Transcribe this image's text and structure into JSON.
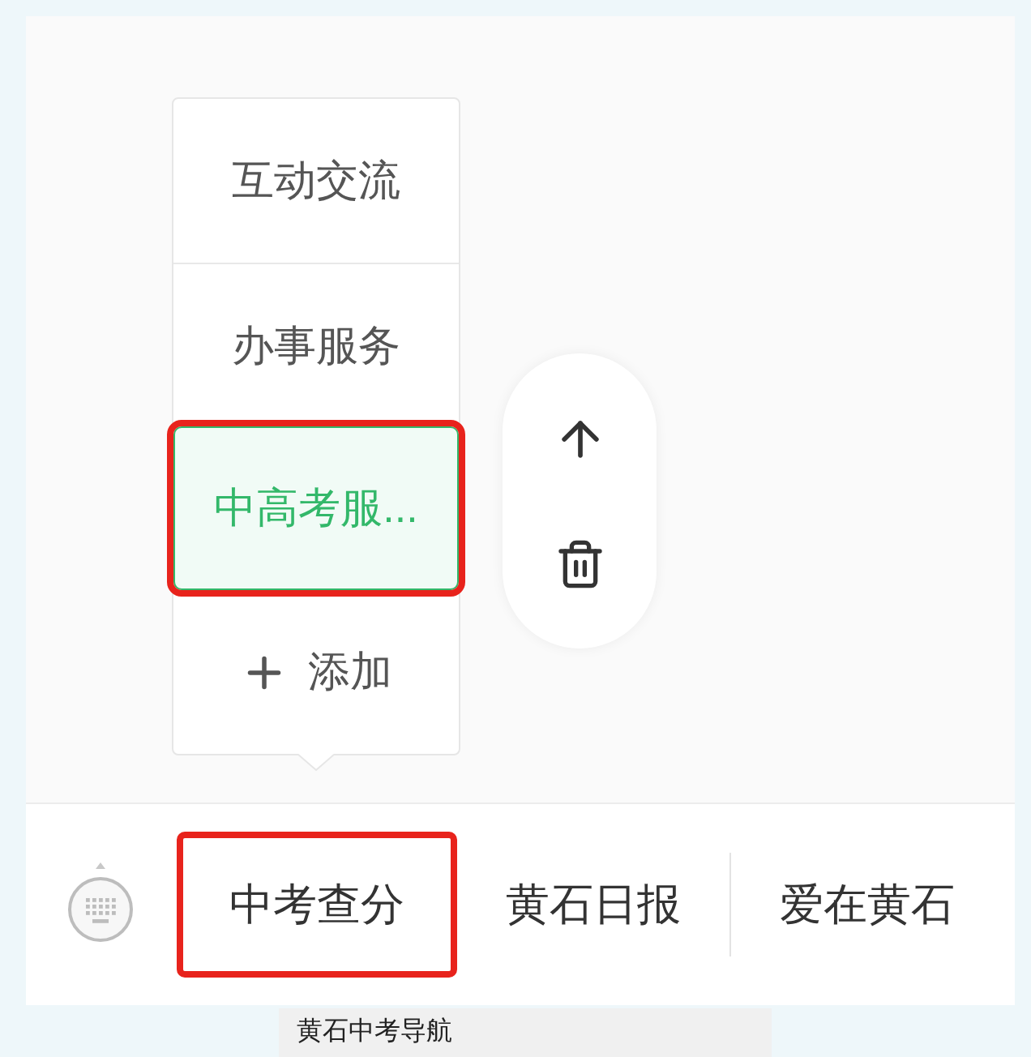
{
  "menu": {
    "items": [
      {
        "label": "互动交流",
        "selected": false,
        "highlighted": false
      },
      {
        "label": "办事服务",
        "selected": false,
        "highlighted": false
      },
      {
        "label": "中高考服...",
        "selected": true,
        "highlighted": true
      }
    ],
    "add_label": "添加"
  },
  "bottom_bar": {
    "tabs": [
      {
        "label": "中考查分",
        "highlighted": true,
        "divider_before": false
      },
      {
        "label": "黄石日报",
        "highlighted": false,
        "divider_before": false
      },
      {
        "label": "爱在黄石",
        "highlighted": false,
        "divider_before": true
      }
    ]
  },
  "caption": "黄石中考导航"
}
